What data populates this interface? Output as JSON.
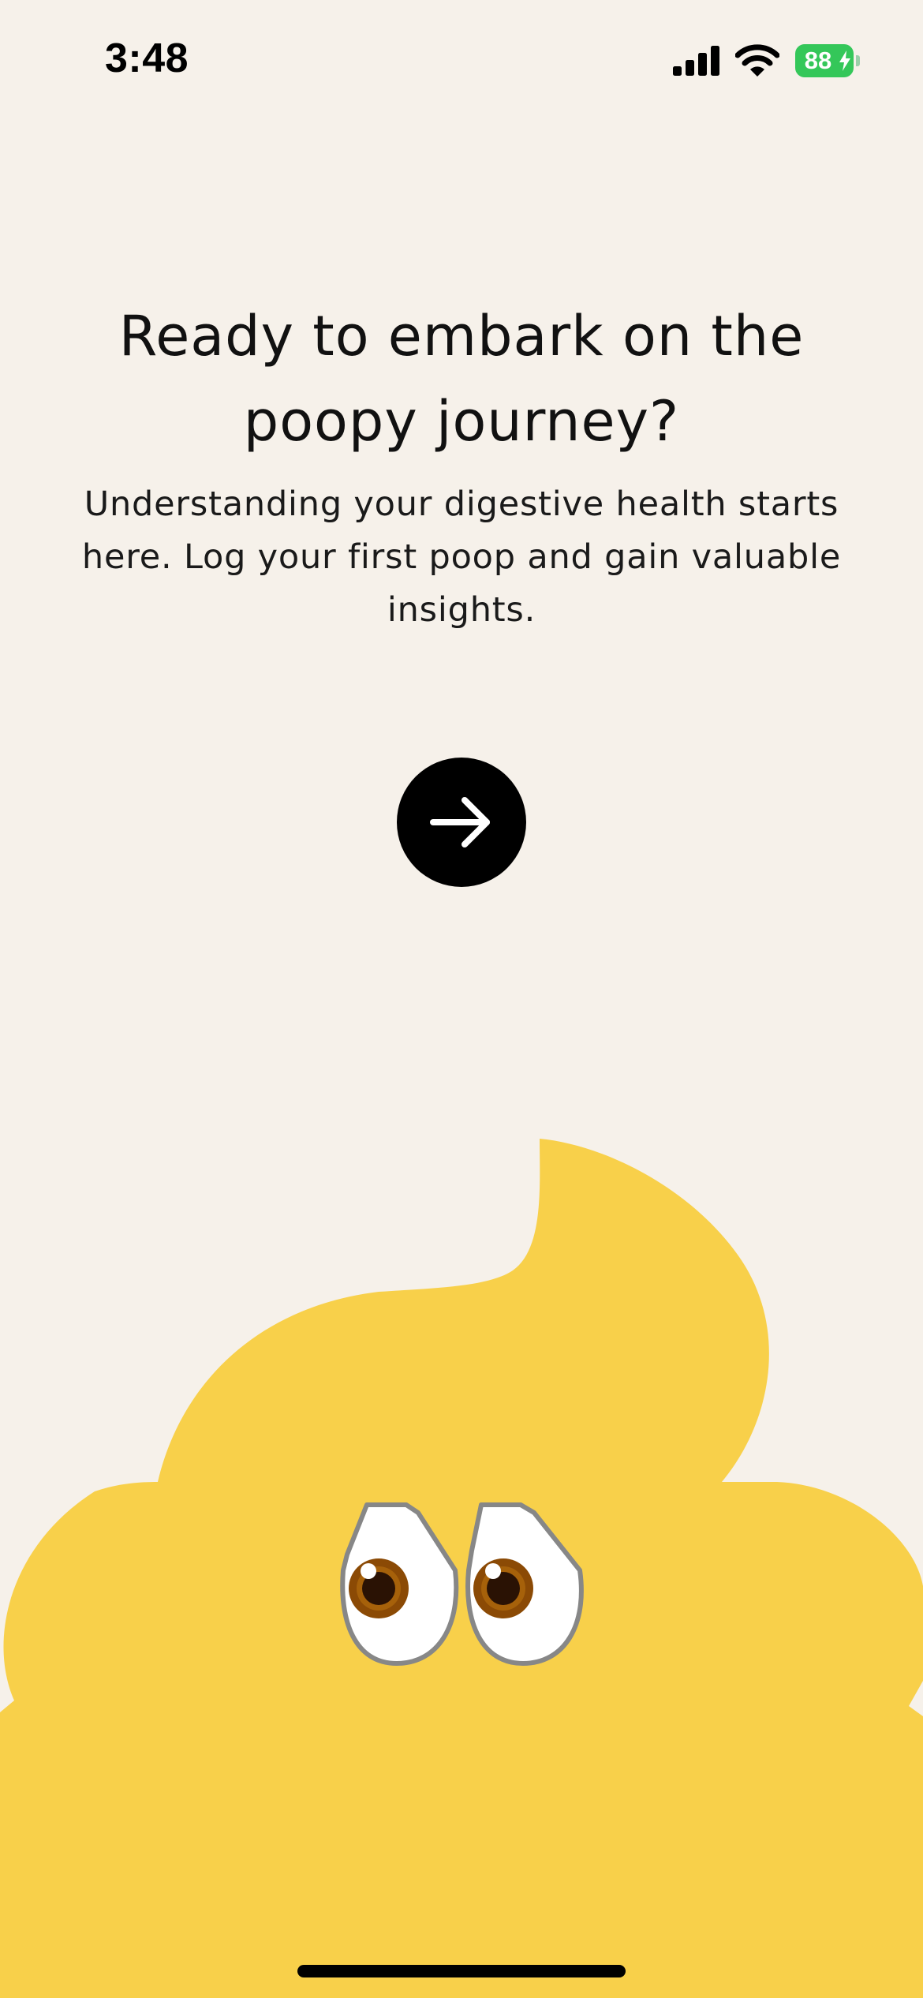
{
  "status_bar": {
    "time": "3:48",
    "battery_level": "88",
    "battery_color": "#34C759",
    "icons": [
      "signal-icon",
      "wifi-icon",
      "battery-icon",
      "charging-bolt-icon"
    ]
  },
  "onboarding": {
    "title": "Ready to embark on the poopy journey?",
    "description": "Understanding your digestive health starts here. Log your first poop and gain valuable insights.",
    "next_button_icon": "arrow-right-icon"
  },
  "mascot": {
    "name": "poop-mascot-illustration",
    "body_color": "#F8D04A",
    "iris_color": "#8B4A05"
  },
  "colors": {
    "background": "#F6F1EA",
    "text": "#111111",
    "button": "#000000"
  }
}
